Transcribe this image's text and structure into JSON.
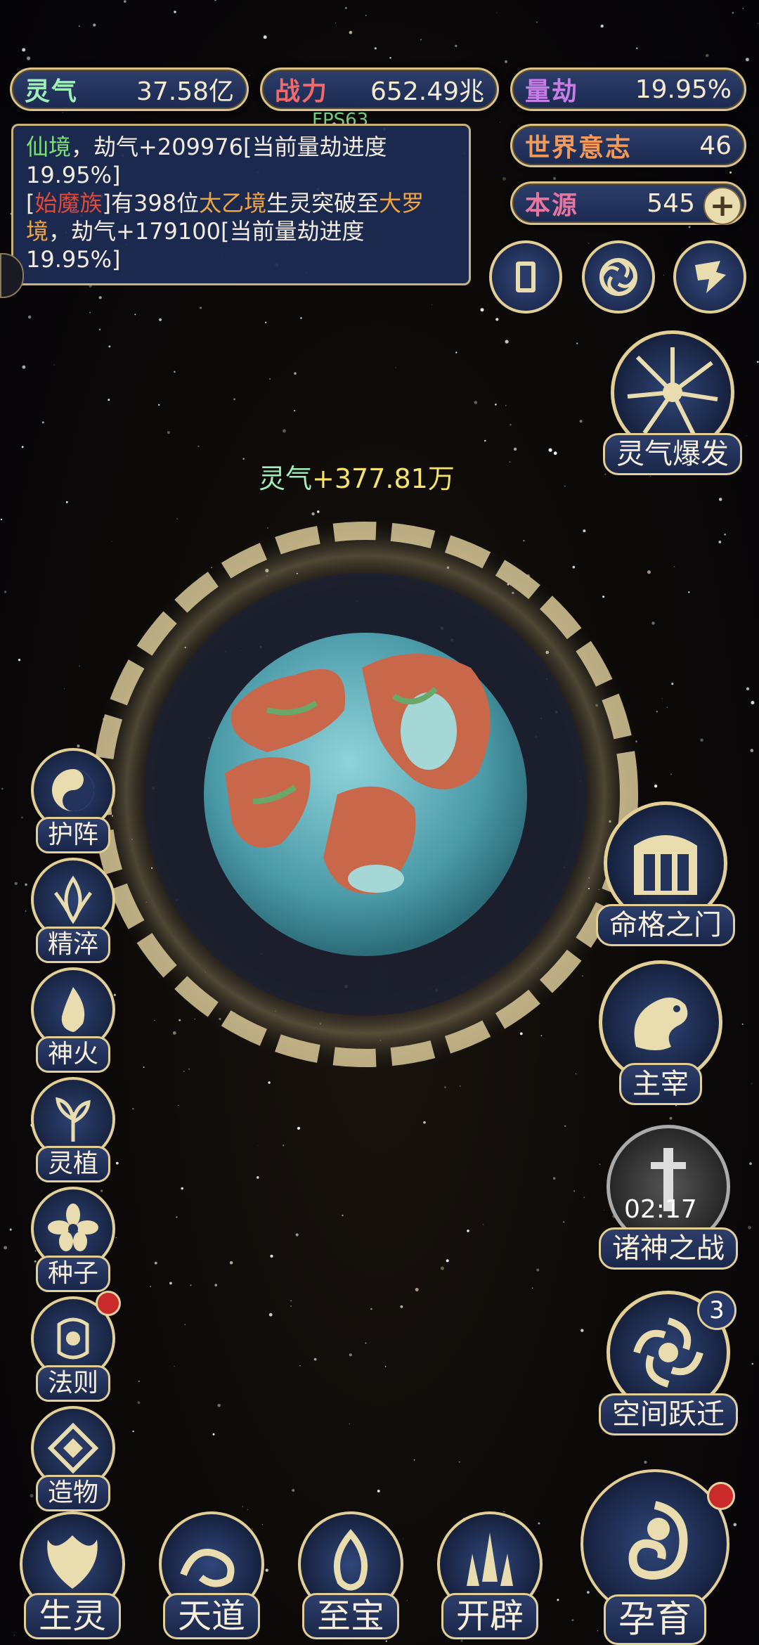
{
  "hud": {
    "lingqi": {
      "label": "灵气",
      "value": "37.58亿"
    },
    "zhanli": {
      "label": "战力",
      "value": "652.49兆"
    },
    "liangjie": {
      "label": "量劫",
      "value": "19.95%"
    },
    "shijie": {
      "label": "世界意志",
      "value": "46"
    },
    "benyuan": {
      "label": "本源",
      "value": "545"
    },
    "fps": "FPS63"
  },
  "log": {
    "line1_realm": "仙境",
    "line1_text": "，劫气+209976[当前量劫进度19.95%]",
    "line2_open": "[",
    "line2_race": "始魔族",
    "line2_mid": "]有398位",
    "line2_realm1": "太乙境",
    "line2_mid2": "生灵突破至",
    "line2_realm2": "大罗境",
    "line2_end": "，劫气+179100[当前量劫进度19.95%]"
  },
  "gain": {
    "label": "灵气",
    "value": "+377.81万"
  },
  "right_top_buttons": [
    "card-icon",
    "vortex-icon",
    "flag-icon"
  ],
  "burst": {
    "label": "灵气爆发"
  },
  "left_menu": [
    "护阵",
    "精淬",
    "神火",
    "灵植",
    "种子",
    "法则",
    "造物"
  ],
  "right_menu": {
    "gate": "命格之门",
    "lord": "主宰",
    "war": "诸神之战",
    "war_timer": "02:17",
    "jump": "空间跃迁",
    "jump_badge": "3"
  },
  "bottom_menu": [
    "生灵",
    "天道",
    "至宝",
    "开辟"
  ],
  "nurture": "孕育",
  "colors": {
    "gold": "#e2cf96",
    "panel": "#1e2c52",
    "green_text": "#7ce07a",
    "orange_text": "#f0a640",
    "red_text": "#e04a3a",
    "pink_text": "#f06a8a"
  }
}
